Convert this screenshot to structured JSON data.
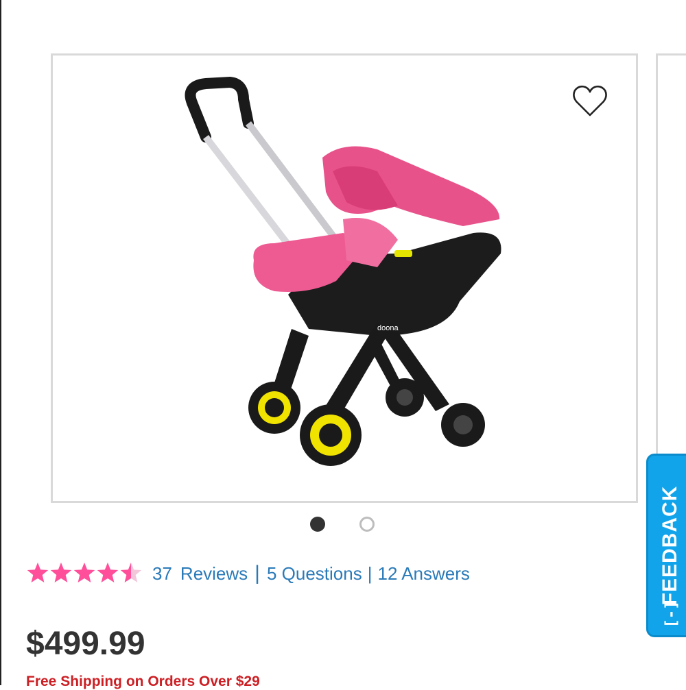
{
  "product": {
    "image_alt": "Pink infant car seat stroller",
    "brand_mark": "doona",
    "wishlist_icon": "heart-outline-icon"
  },
  "carousel": {
    "total": 2,
    "active": 1
  },
  "rating": {
    "value": 4.5,
    "max": 5,
    "star_color": "#ff4f9a",
    "reviews_count": "37",
    "reviews_label": "Reviews",
    "separator": "|",
    "questions": "5 Questions",
    "answers": "12 Answers"
  },
  "price": {
    "amount": "$499.99"
  },
  "shipping": {
    "text": "Free Shipping on Orders Over $29"
  },
  "feedback": {
    "label": "FEEDBACK",
    "icon": "[-]",
    "color": "#12a4ea"
  }
}
